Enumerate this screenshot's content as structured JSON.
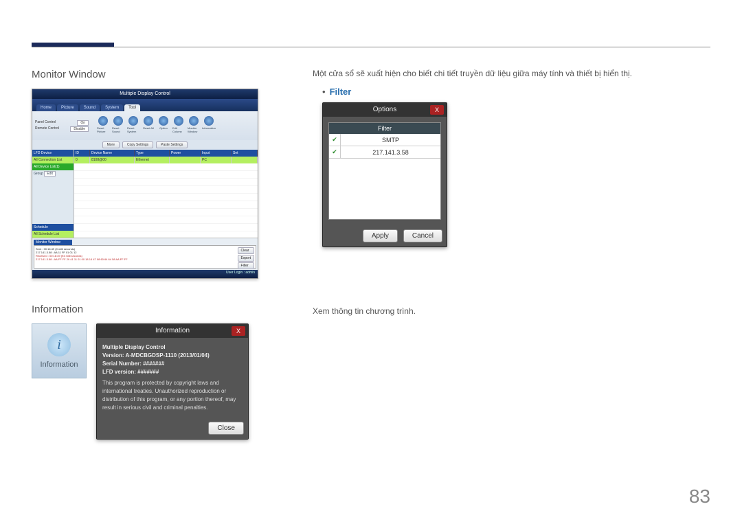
{
  "page_number": "83",
  "section1": {
    "title": "Monitor Window",
    "desc": "Một cửa sổ sẽ xuất hiện cho biết chi tiết truyền dữ liệu giữa máy tính và thiết bị hiển thị.",
    "bullet": "Filter"
  },
  "section2": {
    "title": "Information",
    "desc": "Xem thông tin chương trình.",
    "icon_label": "Information"
  },
  "app": {
    "title": "Multiple Display Control",
    "tabs": [
      "Home",
      "Picture",
      "Sound",
      "System",
      "Tool"
    ],
    "panel_control": "Panel Control",
    "remote_control": "Remote Control",
    "on": "On",
    "disable": "Disable",
    "toolbar_icons": [
      "Reset Picture",
      "Reset Sound",
      "Reset System",
      "Reset All",
      "Option",
      "Edit Column",
      "Monitor Window",
      "Information"
    ],
    "mini_buttons": [
      "More",
      "Copy Settings",
      "Paste Settings"
    ],
    "sidebar": {
      "header": "LFD Device",
      "items": [
        "All Connection List",
        "All Device List(1)"
      ],
      "group": "Group",
      "edit": "Edit",
      "schedule": "Schedule",
      "all_schedule": "All Schedule List"
    },
    "grid_headers": [
      "ID",
      "Device Name",
      "Type",
      "Power",
      "Input",
      "Set"
    ],
    "grid_row": [
      "0",
      "8108@00",
      "Ethernet",
      "",
      "PC",
      ""
    ],
    "monitor": {
      "title": "Monitor Window",
      "sent": "Sent : 00:16:49 (0 milli seconds)",
      "ip": "217.141.3.58 : AA 11 FF 01 01 12",
      "received": "Received : 00:16:49 (94 milli seconds)",
      "data": "217.141.3.58 : AA FF FF 29 41 11 01 00 18 14 47 08 60 64 64 58 AA FF FF",
      "buttons": [
        "Clear",
        "Export",
        "Filter"
      ]
    },
    "footer_user": "User Login : admin"
  },
  "filter_dialog": {
    "title": "Options",
    "col_header": "Filter",
    "rows": [
      "SMTP",
      "217.141.3.58"
    ],
    "apply": "Apply",
    "cancel": "Cancel"
  },
  "info_dialog": {
    "title": "Information",
    "product": "Multiple Display Control",
    "version": "Version: A-MDCBGDSP-1110  (2013/01/04)",
    "serial": "Serial Number: #######",
    "lfd": "LFD version: #######",
    "legal": "This program is protected by copyright laws and international treaties. Unauthorized reproduction or distribution of this program, or any portion thereof, may result in serious civil and criminal penalties.",
    "close": "Close"
  }
}
